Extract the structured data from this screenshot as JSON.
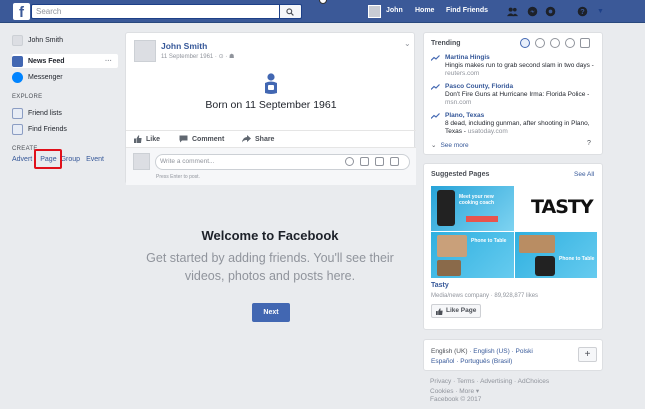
{
  "topbar": {
    "logo": "f",
    "search_placeholder": "Search",
    "user_name": "John",
    "home_label": "Home",
    "find_friends_label": "Find Friends",
    "accent": "#3b5998"
  },
  "left_nav": {
    "profile_name": "John Smith",
    "news_feed": "News Feed",
    "news_feed_more": "···",
    "messenger": "Messenger",
    "explore_header": "EXPLORE",
    "friend_lists": "Friend lists",
    "find_friends": "Find Friends",
    "create_header": "CREATE",
    "create_links": [
      "Advert",
      "Page",
      "Group",
      "Event"
    ]
  },
  "post": {
    "author": "John Smith",
    "date": "11 September 1961",
    "date_suffix": " · ⊙ · ☗",
    "event_text": "Born on 11 September 1961",
    "like_label": "Like",
    "comment_label": "Comment",
    "share_label": "Share",
    "comment_placeholder": "Write a comment...",
    "comment_hint": "Press Enter to post."
  },
  "welcome": {
    "title": "Welcome to Facebook",
    "text_line1": "Get started by adding friends. You'll see their",
    "text_line2": "videos, photos and posts here.",
    "next_label": "Next"
  },
  "trending": {
    "header": "Trending",
    "items": [
      {
        "title": "Martina Hingis",
        "desc": "Hingis makes run to grab second slam in two days",
        "source": "reuters.com"
      },
      {
        "title": "Pasco County, Florida",
        "desc": "Don't Fire Guns at Hurricane Irma: Florida Police",
        "source": "msn.com"
      },
      {
        "title": "Plano, Texas",
        "desc": "8 dead, including gunman, after shooting in Plano, Texas",
        "source": "usatoday.com"
      }
    ],
    "see_more": "See more",
    "help": "?"
  },
  "suggested": {
    "header": "Suggested Pages",
    "see_all": "See All",
    "tasty_logo": "TASTY",
    "img_caption_1": "Meet your new cooking coach",
    "img_caption_2": "Phone to Table",
    "img_caption_3": "Phone to Table",
    "page_name": "Tasty",
    "page_meta": "Media/news company · 89,928,877 likes",
    "like_page_label": "Like Page"
  },
  "languages": {
    "line1": [
      "English (UK)",
      "English (US)",
      "Polski"
    ],
    "line2": [
      "Español",
      "Português (Brasil)"
    ],
    "plus": "+"
  },
  "footer": {
    "line1": "Privacy · Terms · Advertising · AdChoices",
    "line2": "Cookies · More ▾",
    "line3": "Facebook © 2017"
  }
}
